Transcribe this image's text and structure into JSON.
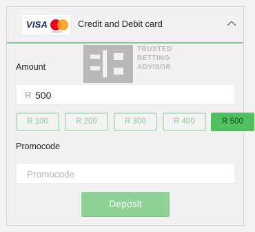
{
  "payment_method": {
    "logos": {
      "visa": "VISA",
      "mastercard_caption": "mastercard"
    },
    "title": "Credit and Debit card",
    "chevron_icon": "chevron-up-icon"
  },
  "watermark": {
    "line1": "TRUSTED",
    "line2": "BETTING",
    "line3": "ADVISOR"
  },
  "amount": {
    "label": "Amount",
    "currency": "R",
    "value": "500"
  },
  "quick_amounts": [
    {
      "label": "R 100",
      "selected": false
    },
    {
      "label": "R 200",
      "selected": false
    },
    {
      "label": "R 300",
      "selected": false
    },
    {
      "label": "R 400",
      "selected": false
    },
    {
      "label": "R 500",
      "selected": true
    }
  ],
  "promocode": {
    "label": "Promocode",
    "placeholder": "Promocode",
    "value": ""
  },
  "deposit_button": {
    "label": "Deposit"
  },
  "colors": {
    "accent": "#4fc25f",
    "accent_light": "#8fd197",
    "chip_border": "#b9e1c1"
  }
}
